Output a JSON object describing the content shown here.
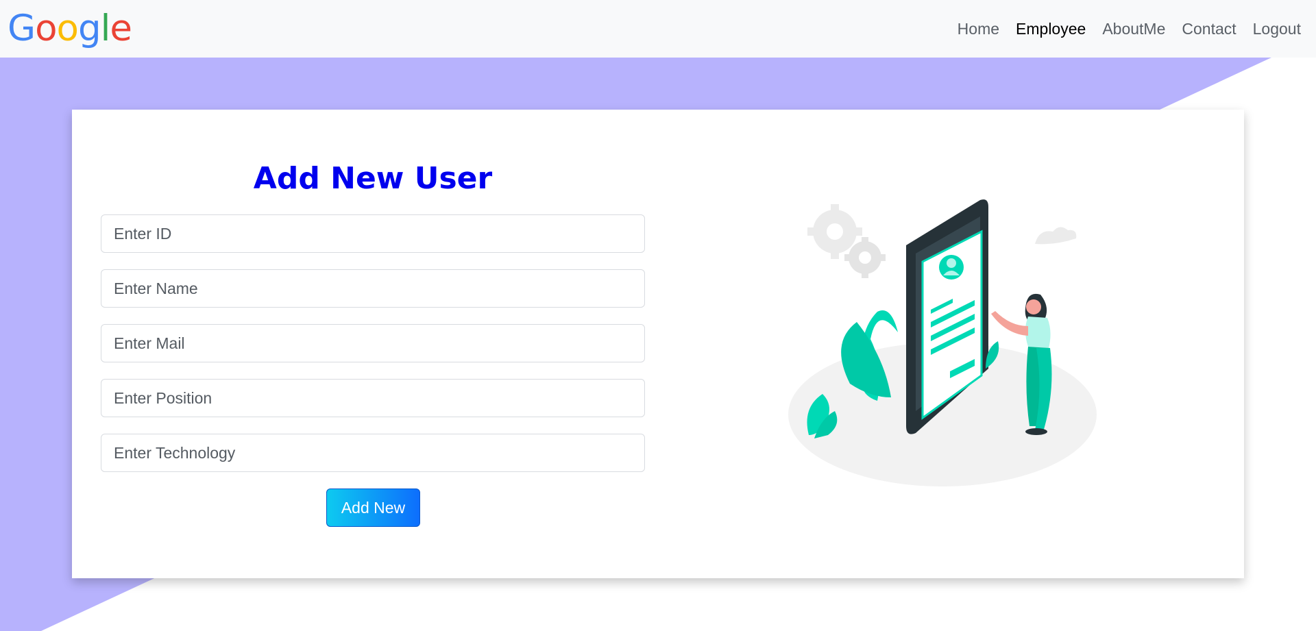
{
  "brand": {
    "logo_text": "Google",
    "logo_letters": [
      "G",
      "o",
      "o",
      "g",
      "l",
      "e"
    ],
    "logo_colors": [
      "#4285f4",
      "#ea4335",
      "#fbbc05",
      "#4285f4",
      "#34a853",
      "#ea4335"
    ]
  },
  "nav": {
    "items": [
      {
        "label": "Home",
        "active": false
      },
      {
        "label": "Employee",
        "active": true
      },
      {
        "label": "AboutMe",
        "active": false
      },
      {
        "label": "Contact",
        "active": false
      },
      {
        "label": "Logout",
        "active": false
      }
    ]
  },
  "form": {
    "title": "Add New User",
    "fields": [
      {
        "placeholder": "Enter ID",
        "value": ""
      },
      {
        "placeholder": "Enter Name",
        "value": ""
      },
      {
        "placeholder": "Enter Mail",
        "value": ""
      },
      {
        "placeholder": "Enter Position",
        "value": ""
      },
      {
        "placeholder": "Enter Technology",
        "value": ""
      }
    ],
    "submit_label": "Add New"
  },
  "illustration": {
    "icon": "user-registration-illustration"
  },
  "colors": {
    "background_shape": "#b7b2fd",
    "title": "#0000ee",
    "button_start": "#0dcaf0",
    "button_end": "#0d6efd",
    "illustration_accent": "#00d9b5"
  }
}
